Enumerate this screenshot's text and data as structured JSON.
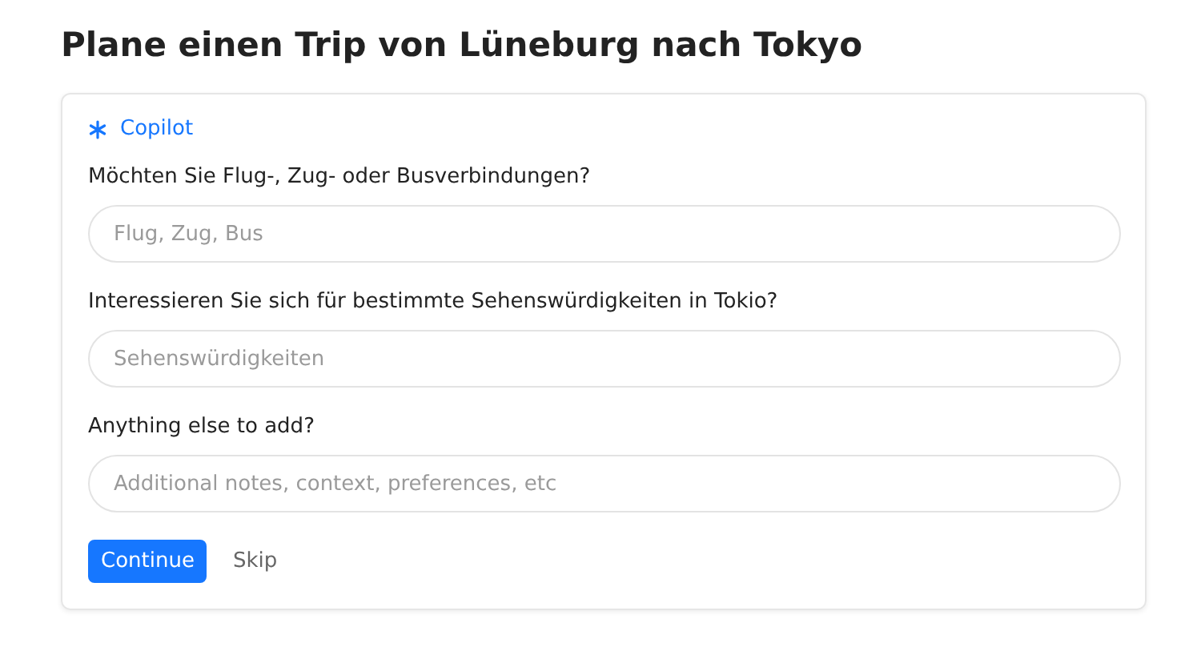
{
  "title": "Plane einen Trip von Lüneburg nach Tokyo",
  "card": {
    "brand": "Copilot",
    "questions": [
      {
        "label": "Möchten Sie Flug-, Zug- oder Busverbindungen?",
        "placeholder": "Flug, Zug, Bus"
      },
      {
        "label": "Interessieren Sie sich für bestimmte Sehenswürdigkeiten in Tokio?",
        "placeholder": "Sehenswürdigkeiten"
      },
      {
        "label": "Anything else to add?",
        "placeholder": "Additional notes, context, preferences, etc"
      }
    ],
    "buttons": [
      {
        "label": "Continue",
        "kind": "primary"
      },
      {
        "label": "Skip",
        "kind": "plain"
      }
    ]
  }
}
